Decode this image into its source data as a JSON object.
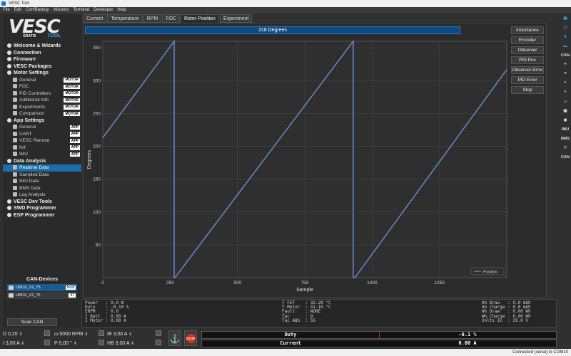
{
  "window": {
    "title": "VESC Tool"
  },
  "menu": [
    "File",
    "Edit",
    "ConfBackup",
    "Wizards",
    "Terminal",
    "Developer",
    "Help"
  ],
  "logo": {
    "main": "VESC",
    "gratis": "GRATIS",
    "tool": "TOOL"
  },
  "nav": [
    {
      "label": "Welcome & Wizards",
      "kind": "group"
    },
    {
      "label": "Connection",
      "kind": "group"
    },
    {
      "label": "Firmware",
      "kind": "group"
    },
    {
      "label": "VESC Packages",
      "kind": "group"
    },
    {
      "label": "Motor Settings",
      "kind": "group"
    },
    {
      "label": "General",
      "kind": "sub",
      "tag": "MOTOR"
    },
    {
      "label": "FOC",
      "kind": "sub",
      "tag": "MOTOR"
    },
    {
      "label": "PID Controllers",
      "kind": "sub",
      "tag": "MOTOR"
    },
    {
      "label": "Additional Info",
      "kind": "sub",
      "tag": "MOTOR"
    },
    {
      "label": "Experiments",
      "kind": "sub",
      "tag": "MOTOR"
    },
    {
      "label": "Comparison",
      "kind": "sub",
      "tag": "MOTOR"
    },
    {
      "label": "App Settings",
      "kind": "group"
    },
    {
      "label": "General",
      "kind": "sub",
      "tag": "APP"
    },
    {
      "label": "UART",
      "kind": "sub",
      "tag": "APP"
    },
    {
      "label": "VESC Remote",
      "kind": "sub",
      "tag": "APP"
    },
    {
      "label": "Nrf",
      "kind": "sub",
      "tag": "APP"
    },
    {
      "label": "IMU",
      "kind": "sub",
      "tag": "APP"
    },
    {
      "label": "Data Analysis",
      "kind": "group"
    },
    {
      "label": "Realtime Data",
      "kind": "sub",
      "selected": true
    },
    {
      "label": "Sampled Data",
      "kind": "sub"
    },
    {
      "label": "IMU Data",
      "kind": "sub"
    },
    {
      "label": "BMS Data",
      "kind": "sub"
    },
    {
      "label": "Log Analysis",
      "kind": "sub"
    },
    {
      "label": "VESC Dev Tools",
      "kind": "group"
    },
    {
      "label": "SWD Programmer",
      "kind": "group"
    },
    {
      "label": "ESP Programmer",
      "kind": "group"
    }
  ],
  "can": {
    "title": "CAN-Devices",
    "devices": [
      {
        "name": "UBOX_V2_75",
        "badge": "local"
      },
      {
        "name": "UBOX_V2_75",
        "badge": "97"
      }
    ],
    "scan_label": "Scan CAN"
  },
  "tabs": [
    "Current",
    "Temperature",
    "RPM",
    "FOC",
    "Rotor Position",
    "Experiment"
  ],
  "active_tab": "Rotor Position",
  "position_bar": {
    "label": "318 Degrees"
  },
  "side_buttons": [
    "Inductance",
    "Encoder",
    "Observer",
    "PID Pos",
    "Observer Error",
    "PID Error",
    "Stop"
  ],
  "toolstrip": [
    "",
    "",
    "",
    "",
    "CAN",
    "",
    "",
    "",
    "",
    "",
    "",
    "",
    "IMU",
    "BMS",
    "",
    "CAN"
  ],
  "chart_data": {
    "type": "line",
    "xlabel": "Sample",
    "ylabel": "Degrees",
    "xlim": [
      0,
      1500
    ],
    "ylim": [
      0,
      360
    ],
    "xticks": [
      0,
      250,
      500,
      750,
      1000,
      1250
    ],
    "yticks": [
      50,
      100,
      150,
      200,
      250,
      300,
      350
    ],
    "grid": true,
    "legend_position": "bottom-right",
    "series": [
      {
        "name": "Position",
        "color": "#6a8fd4",
        "x": [
          0,
          265,
          265,
          268,
          930,
          930,
          936,
          1500
        ],
        "y": [
          213,
          360,
          0,
          0,
          360,
          0,
          0,
          317
        ]
      }
    ]
  },
  "info": {
    "col1": "Power   : 0.0 W\nDuty    : -0.10 %\nERPM    : 0.0\nI Batt  : 0.00 A\nI Motor : 0.00 A",
    "col2": "T FET    : 32.20 °C\nT Motor  : 41.10 °C\nFault    : NONE\nTac      : 9\nTac ABS  : 55",
    "col3": "Ah Draw   : 0.0 mAh\nAh Charge : 0.0 mAh\nWh Draw   : 0.00 Wh\nWh Charge : 0.00 Wh\nVolts In  : 29.0 V"
  },
  "controls": {
    "d_value": "D 0,20",
    "rpm_value": "ω 5000 RPM",
    "ib_value": "IB 3,00 A",
    "i_value": "I 3,00 A",
    "p_value": "P 0,00 °",
    "hb_value": "HB 3,00 A",
    "stop_label": "STOP",
    "anchor_glyph": "⚓"
  },
  "meters": [
    {
      "label": "Duty",
      "value": "-0.1 %"
    },
    {
      "label": "Current",
      "value": "0.00 A"
    }
  ],
  "status": "Connected (serial) to COM10"
}
